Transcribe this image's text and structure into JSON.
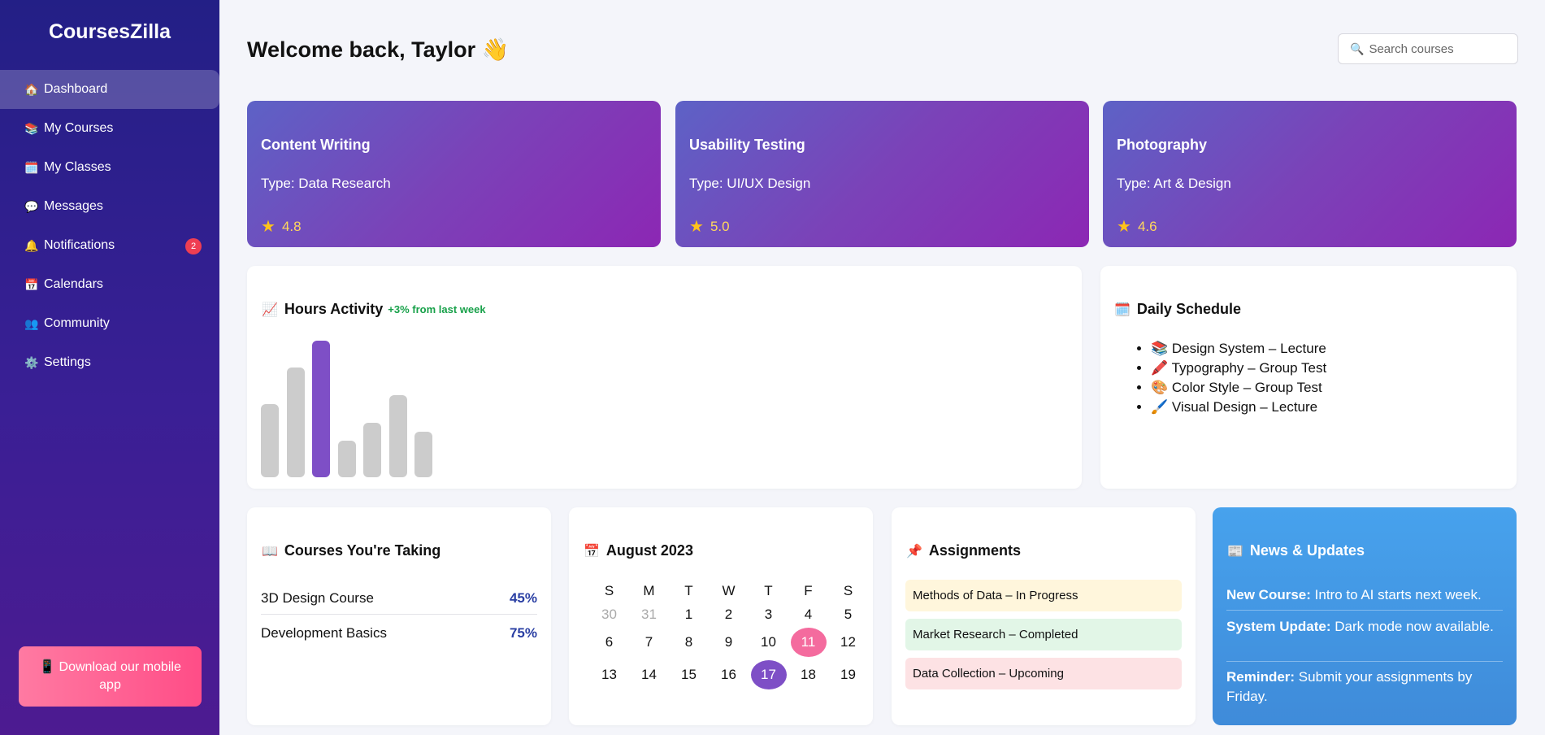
{
  "app": {
    "brand": "CoursesZilla"
  },
  "sidebar": {
    "items": [
      {
        "icon": "🏠",
        "label": "Dashboard",
        "active": true
      },
      {
        "icon": "📚",
        "label": "My Courses"
      },
      {
        "icon": "🗓️",
        "label": "My Classes"
      },
      {
        "icon": "💬",
        "label": "Messages"
      },
      {
        "icon": "🔔",
        "label": "Notifications",
        "badge": "2"
      },
      {
        "icon": "📅",
        "label": "Calendars"
      },
      {
        "icon": "👥",
        "label": "Community"
      },
      {
        "icon": "⚙️",
        "label": "Settings"
      }
    ],
    "download": {
      "icon": "📱",
      "label": "Download our mobile app"
    }
  },
  "header": {
    "welcome": "Welcome back, Taylor 👋",
    "search_placeholder": "Search courses",
    "search_icon": "🔍"
  },
  "course_cards": [
    {
      "title": "Content Writing",
      "type": "Type: Data Research",
      "rating": "4.8"
    },
    {
      "title": "Usability Testing",
      "type": "Type: UI/UX Design",
      "rating": "5.0"
    },
    {
      "title": "Photography",
      "type": "Type: Art & Design",
      "rating": "4.6"
    }
  ],
  "hours_activity": {
    "icon": "📈",
    "title": "Hours Activity",
    "growth": "+3% from last week",
    "bars": [
      {
        "value": 90,
        "highlight": false
      },
      {
        "value": 135,
        "highlight": false
      },
      {
        "value": 168,
        "highlight": true
      },
      {
        "value": 45,
        "highlight": false
      },
      {
        "value": 67,
        "highlight": false
      },
      {
        "value": 101,
        "highlight": false
      },
      {
        "value": 56,
        "highlight": false
      }
    ]
  },
  "daily_schedule": {
    "icon": "🗓️",
    "title": "Daily Schedule",
    "items": [
      "📚 Design System – Lecture",
      "🖍️ Typography – Group Test",
      "🎨 Color Style – Group Test",
      "🖌️ Visual Design – Lecture"
    ]
  },
  "courses_taking": {
    "icon": "📖",
    "title": "Courses You're Taking",
    "items": [
      {
        "name": "3D Design Course",
        "percent": "45%"
      },
      {
        "name": "Development Basics",
        "percent": "75%"
      }
    ]
  },
  "calendar": {
    "icon": "📅",
    "title": "August 2023",
    "weekdays": [
      "S",
      "M",
      "T",
      "W",
      "T",
      "F",
      "S"
    ],
    "weeks": [
      [
        {
          "d": "30",
          "muted": true
        },
        {
          "d": "31",
          "muted": true
        },
        {
          "d": "1"
        },
        {
          "d": "2"
        },
        {
          "d": "3"
        },
        {
          "d": "4"
        },
        {
          "d": "5"
        }
      ],
      [
        {
          "d": "6"
        },
        {
          "d": "7"
        },
        {
          "d": "8"
        },
        {
          "d": "9"
        },
        {
          "d": "10"
        },
        {
          "d": "11",
          "mark": "pink"
        },
        {
          "d": "12"
        }
      ],
      [
        {
          "d": "13"
        },
        {
          "d": "14"
        },
        {
          "d": "15"
        },
        {
          "d": "16"
        },
        {
          "d": "17",
          "mark": "purple"
        },
        {
          "d": "18"
        },
        {
          "d": "19"
        }
      ]
    ],
    "colors": {
      "pink": "#f46b9e",
      "purple": "#7e4fc6"
    }
  },
  "assignments": {
    "icon": "📌",
    "title": "Assignments",
    "items": [
      {
        "label": "Methods of Data – In Progress",
        "color": "#fff6dc"
      },
      {
        "label": "Market Research – Completed",
        "color": "#e2f6e7"
      },
      {
        "label": "Data Collection – Upcoming",
        "color": "#fde2e4"
      }
    ]
  },
  "news": {
    "icon": "📰",
    "title": "News & Updates",
    "items": [
      {
        "bold": "New Course:",
        "text": " Intro to AI starts next week."
      },
      {
        "bold": "System Update:",
        "text": " Dark mode now available."
      },
      {
        "bold": "Reminder:",
        "text": " Submit your assignments by Friday."
      }
    ]
  }
}
